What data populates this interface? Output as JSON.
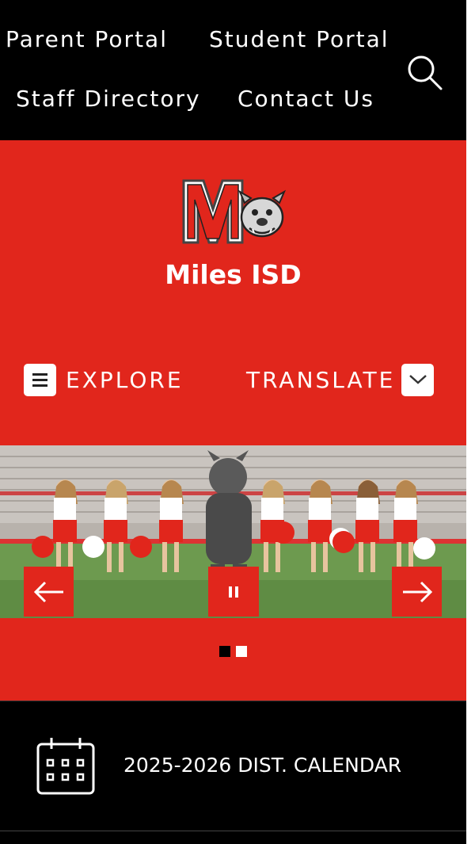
{
  "top_nav": {
    "links": [
      {
        "label": "Parent Portal"
      },
      {
        "label": "Student Portal"
      },
      {
        "label": "Staff Directory"
      },
      {
        "label": "Contact Us"
      }
    ],
    "search_icon": "search-icon"
  },
  "header": {
    "logo_icon": "miles-bulldog-logo",
    "site_title": "Miles ISD",
    "explore_label": "EXPLORE",
    "translate_label": "TRANSLATE"
  },
  "slideshow": {
    "prev_icon": "arrow-left-icon",
    "next_icon": "arrow-right-icon",
    "pause_icon": "pause-icon",
    "slide_count": 2,
    "active_slide": 1
  },
  "quick_link": {
    "icon": "calendar-icon",
    "label": "2025-2026 DIST. CALENDAR"
  },
  "colors": {
    "brand_red": "#e1261c",
    "black": "#000000",
    "white": "#ffffff"
  }
}
